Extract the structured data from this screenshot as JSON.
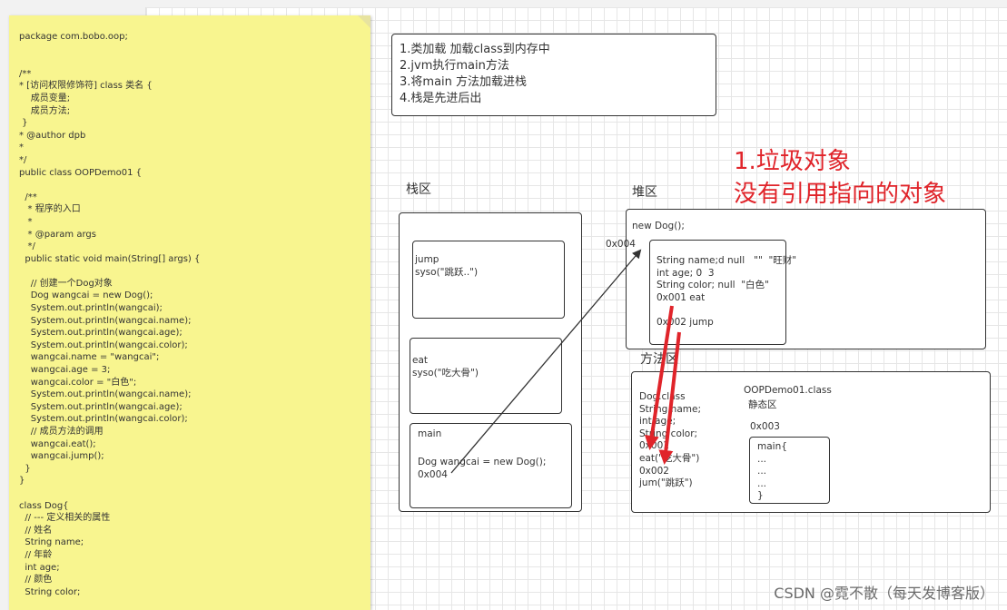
{
  "code_lines": [
    "package com.bobo.oop;",
    "",
    "",
    "/**",
    "* [访问权限修饰符] class 类名 {",
    "    成员变量;",
    "    成员方法;",
    " }",
    "* @author dpb",
    "*",
    "*/",
    "public class OOPDemo01 {",
    "",
    "  /**",
    "   * 程序的入口",
    "   *",
    "   * @param args",
    "   */",
    "  public static void main(String[] args) {",
    "",
    "    // 创建一个Dog对象",
    "    Dog wangcai = new Dog();",
    "    System.out.println(wangcai);",
    "    System.out.println(wangcai.name);",
    "    System.out.println(wangcai.age);",
    "    System.out.println(wangcai.color);",
    "    wangcai.name = \"wangcai\";",
    "    wangcai.age = 3;",
    "    wangcai.color = \"白色\";",
    "    System.out.println(wangcai.name);",
    "    System.out.println(wangcai.age);",
    "    System.out.println(wangcai.color);",
    "    // 成员方法的调用",
    "    wangcai.eat();",
    "    wangcai.jump();",
    "  }",
    "}",
    "",
    "class Dog{",
    "  // --- 定义相关的属性",
    "  // 姓名",
    "  String name;",
    "  // 年龄",
    "  int age;",
    "  // 颜色",
    "  String color;"
  ],
  "steps": [
    "1.类加载 加载class到内存中",
    "2.jvm执行main方法",
    "3.将main 方法加载进栈",
    "4.栈是先进后出"
  ],
  "red_note": [
    "1.垃圾对象",
    "没有引用指向的对象"
  ],
  "stack": {
    "label": "栈区",
    "jump_frame": "jump\nsyso(\"跳跃..\")",
    "eat_frame": "eat\nsyso(\"吃大骨\")",
    "main_frame_title": "main",
    "main_frame_body": "Dog wangcai = new Dog();\n0x004"
  },
  "heap": {
    "label": "堆区",
    "title": "new Dog();",
    "address": "0x004",
    "object_fields": "String name;d null   \"\"  \"旺财\"\nint age; 0  3\nString color; null  \"白色\"\n0x001 eat\n\n0x002 jump"
  },
  "method_area": {
    "label": "方法区",
    "dog_class": "Dog.class\nString name;\nint age;\nString color;\n0x001\neat(\"吃大骨\")\n0x002\njum(\"跳跃\")",
    "demo_class": "OOPDemo01.class",
    "static_area": "静态区",
    "static_address": "0x003",
    "main_block": "main{\n...\n...\n...\n}"
  },
  "watermark": "CSDN @霓不散（每天发博客版）",
  "colors": {
    "note_bg": "#f8f58f",
    "red": "#e0242a",
    "grid": "#e6e6e6"
  }
}
